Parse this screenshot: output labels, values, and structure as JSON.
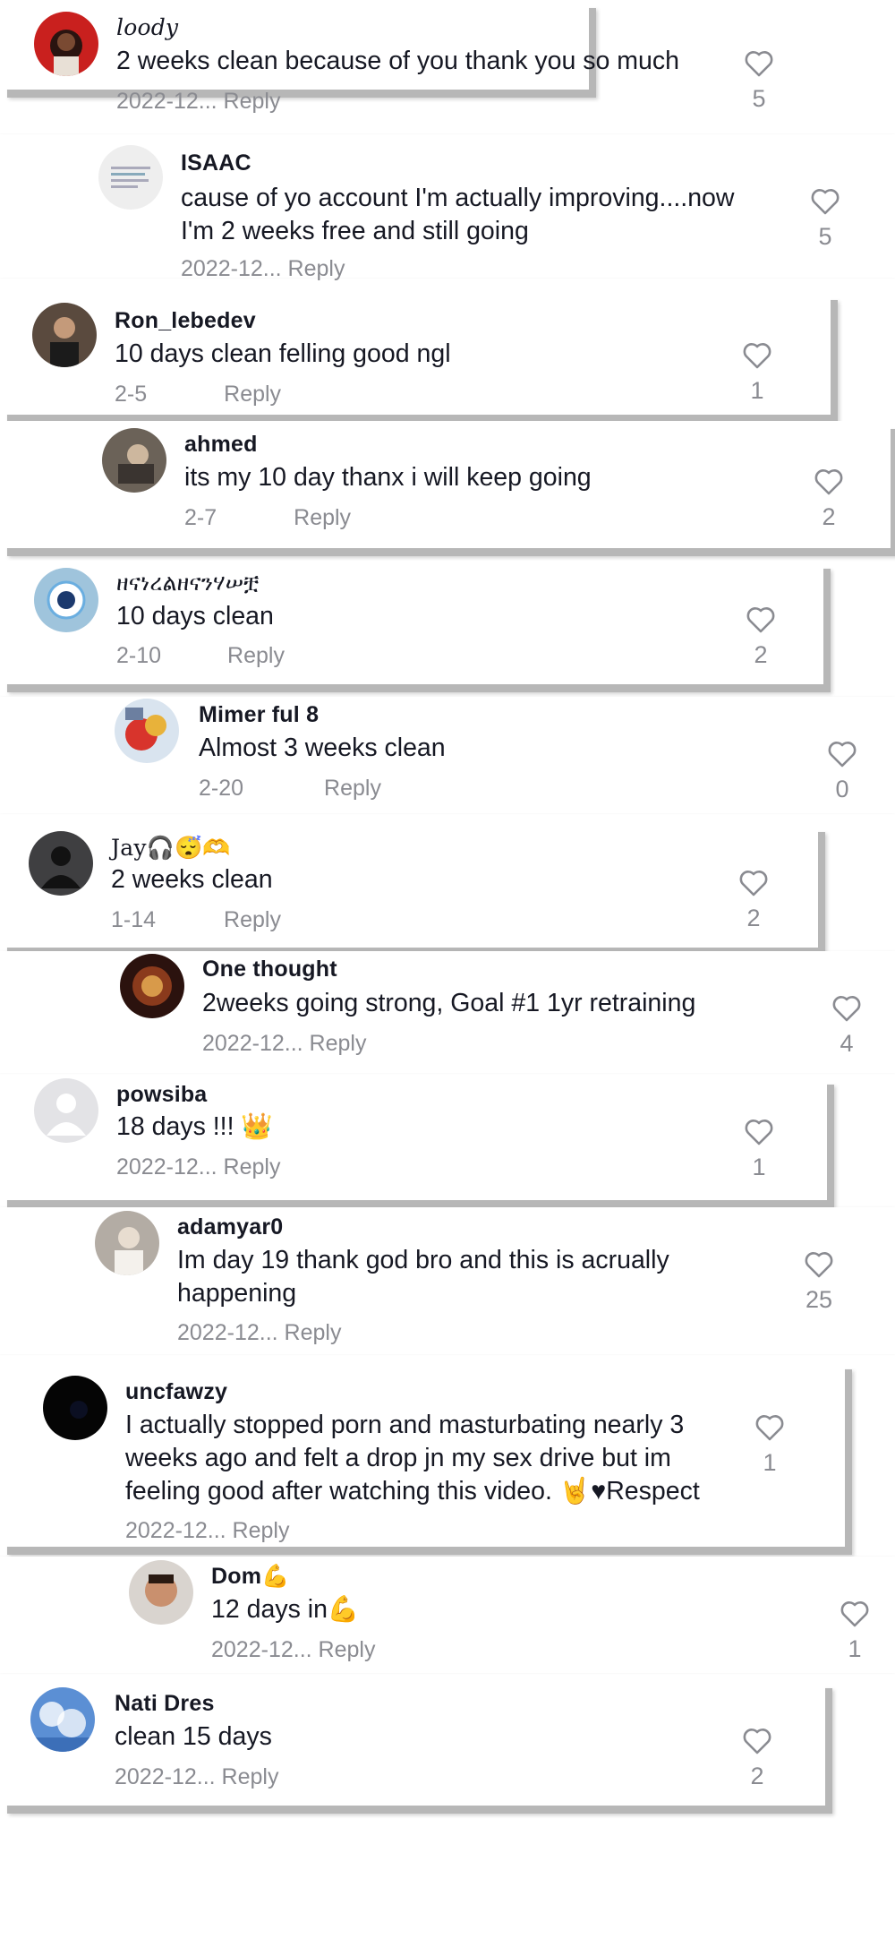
{
  "reply_label": "Reply",
  "comments": [
    {
      "username": "loody",
      "text": [
        "2 weeks clean because of you thank you so much"
      ],
      "date": "2022-12...",
      "likes": "5",
      "avatar": "red-avatar"
    },
    {
      "username": "ISAAC",
      "text": [
        "cause of yo account I'm actually improving....now",
        "I'm 2 weeks free and still going"
      ],
      "date": "2022-12...",
      "likes": "5",
      "avatar": "quote-avatar"
    },
    {
      "username": "Ron_lebedev",
      "text": [
        "10 days clean felling good ngl"
      ],
      "date": "2-5",
      "likes": "1",
      "avatar": "dark-person-avatar"
    },
    {
      "username": "ahmed",
      "text": [
        "its my 10 day thanx i will keep going"
      ],
      "date": "2-7",
      "likes": "2",
      "avatar": "photo-avatar"
    },
    {
      "username": "ዘናነረልዘናንሃሠቿ",
      "text": [
        "10 days clean"
      ],
      "date": "2-10",
      "likes": "2",
      "avatar": "club-badge-avatar"
    },
    {
      "username": "Mimer ful 8",
      "text": [
        "Almost 3 weeks clean"
      ],
      "date": "2-20",
      "likes": "0",
      "avatar": "cartoon-avatar"
    },
    {
      "username": "Jay🎧😴🫶",
      "text": [
        "2 weeks clean"
      ],
      "date": "1-14",
      "likes": "2",
      "avatar": "default-dark-avatar"
    },
    {
      "username": "One thought",
      "text": [
        "2weeks going strong, Goal #1 1yr retraining"
      ],
      "date": "2022-12...",
      "likes": "4",
      "avatar": "lion-avatar"
    },
    {
      "username": "powsiba",
      "text": [
        "18 days !!! 👑"
      ],
      "date": "2022-12...",
      "likes": "1",
      "avatar": "default-light-avatar"
    },
    {
      "username": "adamyar0",
      "text": [
        "Im day 19 thank god bro and this is acrually",
        "happening"
      ],
      "date": "2022-12...",
      "likes": "25",
      "avatar": "mirror-avatar"
    },
    {
      "username": "uncfawzy",
      "text": [
        "I actually stopped porn and masturbating nearly 3",
        "weeks ago and felt a drop jn my sex drive but im",
        "feeling good after watching this video. 🤘♥Respect"
      ],
      "date": "2022-12...",
      "likes": "1",
      "avatar": "black-avatar"
    },
    {
      "username": "Dom💪",
      "text": [
        "12 days in💪"
      ],
      "date": "2022-12...",
      "likes": "1",
      "avatar": "face-avatar"
    },
    {
      "username": "Nati Dres",
      "text": [
        "clean 15 days"
      ],
      "date": "2022-12...",
      "likes": "2",
      "avatar": "sky-avatar"
    }
  ]
}
